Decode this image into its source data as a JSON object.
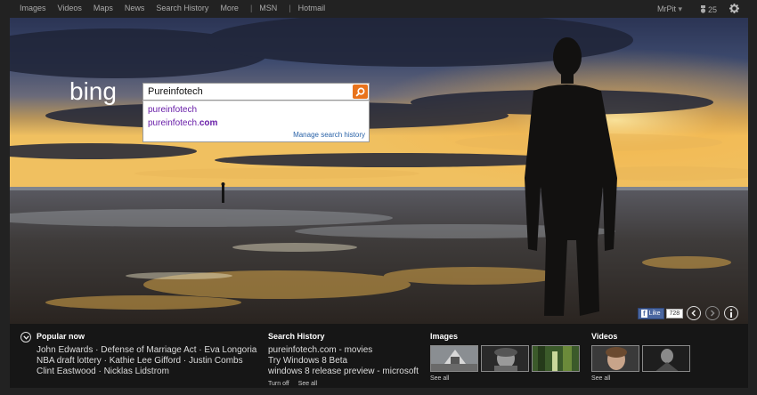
{
  "topnav": {
    "items": [
      "Images",
      "Videos",
      "Maps",
      "News",
      "Search History",
      "More"
    ],
    "extra": [
      "MSN",
      "Hotmail"
    ],
    "separator": "|"
  },
  "topright": {
    "user": "MrPit",
    "rewards": "25"
  },
  "brand": {
    "logo_text": "bing"
  },
  "search": {
    "query": "Pureinfotech",
    "suggestions": [
      {
        "prefix": "pureinfotech",
        "bold": ""
      },
      {
        "prefix": "pureinfotech.",
        "bold": "com"
      }
    ],
    "manage_label": "Manage search history"
  },
  "social": {
    "like_label": "Like",
    "fb_glyph": "f",
    "like_count": "728"
  },
  "bottom": {
    "popular": {
      "title": "Popular now",
      "lines": [
        "John Edwards · Defense of Marriage Act · Eva Longoria",
        "NBA draft lottery · Kathie Lee Gifford · Justin Combs",
        "Clint Eastwood · Nicklas Lidstrom"
      ]
    },
    "history": {
      "title": "Search History",
      "lines": [
        "pureinfotech.com - movies",
        "Try Windows 8 Beta",
        "windows 8 release preview - microsoft"
      ],
      "turn_off": "Turn off",
      "see_all": "See all"
    },
    "images": {
      "title": "Images",
      "see_all": "See all"
    },
    "videos": {
      "title": "Videos",
      "see_all": "See all"
    }
  },
  "colors": {
    "accent": "#e8731c",
    "link": "#681da8",
    "facebook": "#4a66a0"
  }
}
